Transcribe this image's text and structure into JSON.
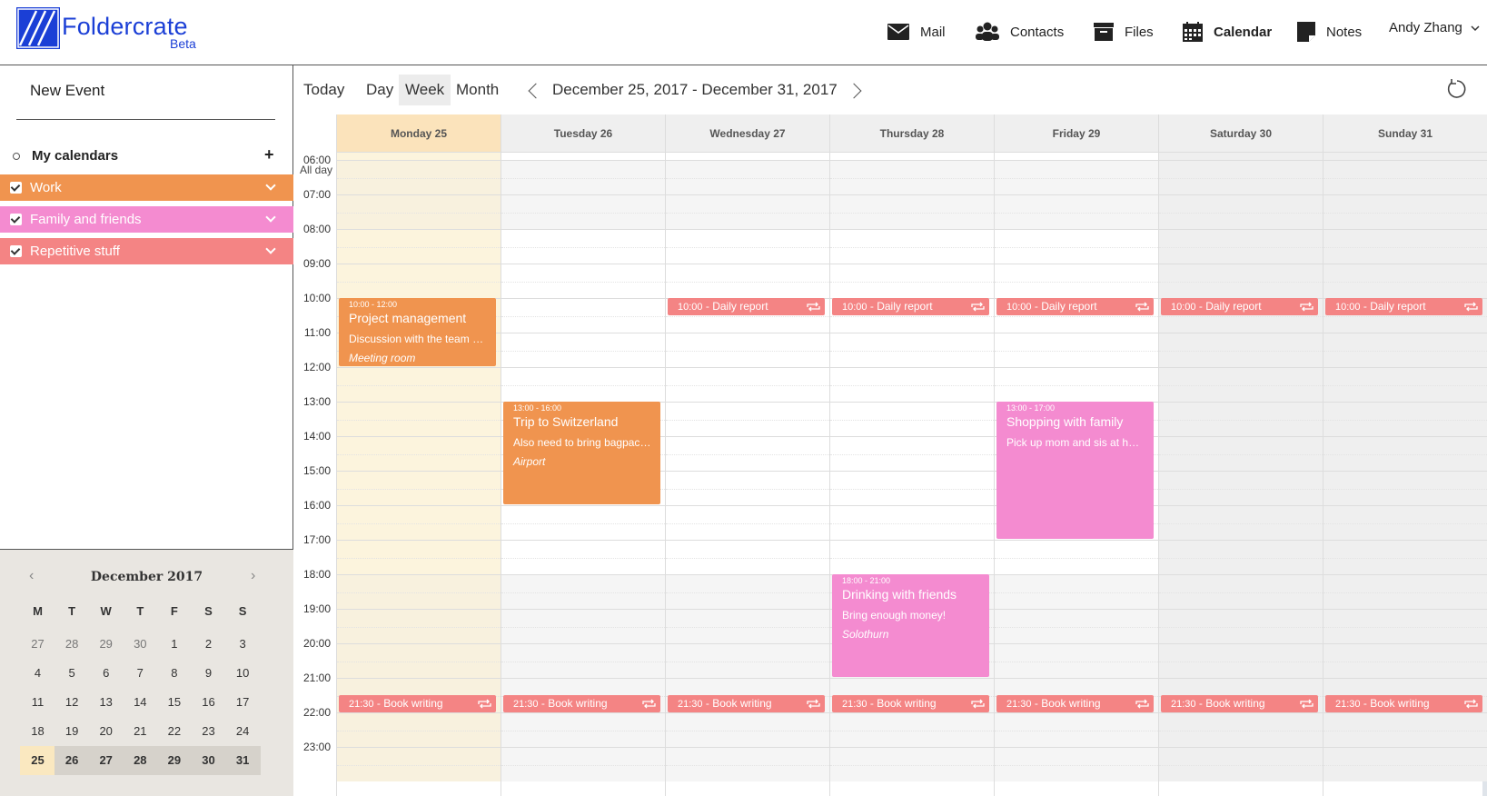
{
  "brand": {
    "name": "Foldercrate",
    "tag": "Beta",
    "color": "#1b3fd6"
  },
  "nav": [
    {
      "label": "Mail",
      "icon": "mail-icon"
    },
    {
      "label": "Contacts",
      "icon": "contacts-icon"
    },
    {
      "label": "Files",
      "icon": "files-icon"
    },
    {
      "label": "Calendar",
      "icon": "calendar-icon",
      "active": true
    },
    {
      "label": "Notes",
      "icon": "notes-icon"
    }
  ],
  "user": {
    "name": "Andy Zhang"
  },
  "sidebar": {
    "new_event": "New Event",
    "my_calendars": "My calendars",
    "calendars": [
      {
        "label": "Work",
        "color": "#f0944f",
        "checked": true
      },
      {
        "label": "Family and friends",
        "color": "#f48bd0",
        "checked": true
      },
      {
        "label": "Repetitive stuff",
        "color": "#f48484",
        "checked": true
      }
    ]
  },
  "mini_calendar": {
    "title": "December 2017",
    "weekdays": [
      "M",
      "T",
      "W",
      "T",
      "F",
      "S",
      "S"
    ],
    "weeks": [
      [
        "27",
        "28",
        "29",
        "30",
        "1",
        "2",
        "3"
      ],
      [
        "4",
        "5",
        "6",
        "7",
        "8",
        "9",
        "10"
      ],
      [
        "11",
        "12",
        "13",
        "14",
        "15",
        "16",
        "17"
      ],
      [
        "18",
        "19",
        "20",
        "21",
        "22",
        "23",
        "24"
      ],
      [
        "25",
        "26",
        "27",
        "28",
        "29",
        "30",
        "31"
      ]
    ],
    "today": "25"
  },
  "toolbar": {
    "views": [
      "Today",
      "Day",
      "Week",
      "Month"
    ],
    "active_view": "Week",
    "range": "December 25, 2017 - December 31, 2017"
  },
  "week": {
    "days": [
      "Monday 25",
      "Tuesday 26",
      "Wednesday 27",
      "Thursday 28",
      "Friday 29",
      "Saturday 30",
      "Sunday 31"
    ],
    "all_day_label": "All day",
    "hours": [
      "06:00",
      "07:00",
      "08:00",
      "09:00",
      "10:00",
      "11:00",
      "12:00",
      "13:00",
      "14:00",
      "15:00",
      "16:00",
      "17:00",
      "18:00",
      "19:00",
      "20:00",
      "21:00",
      "22:00",
      "23:00"
    ]
  },
  "events": [
    {
      "day": 0,
      "start": "10:00",
      "end": "12:00",
      "time": "10:00 - 12:00",
      "title": "Project management",
      "description": "Discussion with the team about the next sprint",
      "location": "Meeting room",
      "calendar": "Work"
    },
    {
      "day": 1,
      "start": "13:00",
      "end": "16:00",
      "time": "13:00 - 16:00",
      "title": "Trip to Switzerland",
      "description": "Also need to bring bagpack and passport",
      "location": "Airport",
      "calendar": "Work"
    },
    {
      "day": 4,
      "start": "13:00",
      "end": "17:00",
      "time": "13:00 - 17:00",
      "title": "Shopping with family",
      "description": "Pick up mom and sis at home first",
      "location": "",
      "calendar": "Family and friends"
    },
    {
      "day": 3,
      "start": "18:00",
      "end": "21:00",
      "time": "18:00 - 21:00",
      "title": "Drinking with friends",
      "description": "Bring enough money!",
      "location": "Solothurn",
      "calendar": "Family and friends"
    }
  ],
  "recurring": [
    {
      "days": [
        2,
        3,
        4,
        5,
        6
      ],
      "time": "10:00",
      "title": "Daily report",
      "calendar": "Repetitive stuff"
    },
    {
      "days": [
        0,
        1,
        2,
        3,
        4,
        5,
        6
      ],
      "time": "21:30",
      "title": "Book writing",
      "calendar": "Repetitive stuff"
    }
  ]
}
